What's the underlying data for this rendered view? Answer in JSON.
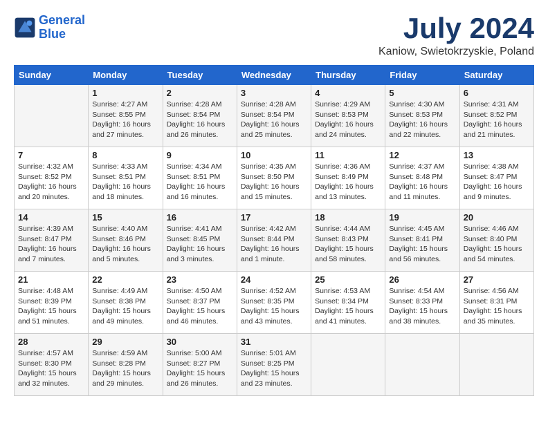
{
  "header": {
    "logo_line1": "General",
    "logo_line2": "Blue",
    "month_title": "July 2024",
    "location": "Kaniow, Swietokrzyskie, Poland"
  },
  "weekdays": [
    "Sunday",
    "Monday",
    "Tuesday",
    "Wednesday",
    "Thursday",
    "Friday",
    "Saturday"
  ],
  "weeks": [
    [
      {
        "day": "",
        "info": ""
      },
      {
        "day": "1",
        "info": "Sunrise: 4:27 AM\nSunset: 8:55 PM\nDaylight: 16 hours\nand 27 minutes."
      },
      {
        "day": "2",
        "info": "Sunrise: 4:28 AM\nSunset: 8:54 PM\nDaylight: 16 hours\nand 26 minutes."
      },
      {
        "day": "3",
        "info": "Sunrise: 4:28 AM\nSunset: 8:54 PM\nDaylight: 16 hours\nand 25 minutes."
      },
      {
        "day": "4",
        "info": "Sunrise: 4:29 AM\nSunset: 8:53 PM\nDaylight: 16 hours\nand 24 minutes."
      },
      {
        "day": "5",
        "info": "Sunrise: 4:30 AM\nSunset: 8:53 PM\nDaylight: 16 hours\nand 22 minutes."
      },
      {
        "day": "6",
        "info": "Sunrise: 4:31 AM\nSunset: 8:52 PM\nDaylight: 16 hours\nand 21 minutes."
      }
    ],
    [
      {
        "day": "7",
        "info": "Sunrise: 4:32 AM\nSunset: 8:52 PM\nDaylight: 16 hours\nand 20 minutes."
      },
      {
        "day": "8",
        "info": "Sunrise: 4:33 AM\nSunset: 8:51 PM\nDaylight: 16 hours\nand 18 minutes."
      },
      {
        "day": "9",
        "info": "Sunrise: 4:34 AM\nSunset: 8:51 PM\nDaylight: 16 hours\nand 16 minutes."
      },
      {
        "day": "10",
        "info": "Sunrise: 4:35 AM\nSunset: 8:50 PM\nDaylight: 16 hours\nand 15 minutes."
      },
      {
        "day": "11",
        "info": "Sunrise: 4:36 AM\nSunset: 8:49 PM\nDaylight: 16 hours\nand 13 minutes."
      },
      {
        "day": "12",
        "info": "Sunrise: 4:37 AM\nSunset: 8:48 PM\nDaylight: 16 hours\nand 11 minutes."
      },
      {
        "day": "13",
        "info": "Sunrise: 4:38 AM\nSunset: 8:47 PM\nDaylight: 16 hours\nand 9 minutes."
      }
    ],
    [
      {
        "day": "14",
        "info": "Sunrise: 4:39 AM\nSunset: 8:47 PM\nDaylight: 16 hours\nand 7 minutes."
      },
      {
        "day": "15",
        "info": "Sunrise: 4:40 AM\nSunset: 8:46 PM\nDaylight: 16 hours\nand 5 minutes."
      },
      {
        "day": "16",
        "info": "Sunrise: 4:41 AM\nSunset: 8:45 PM\nDaylight: 16 hours\nand 3 minutes."
      },
      {
        "day": "17",
        "info": "Sunrise: 4:42 AM\nSunset: 8:44 PM\nDaylight: 16 hours\nand 1 minute."
      },
      {
        "day": "18",
        "info": "Sunrise: 4:44 AM\nSunset: 8:43 PM\nDaylight: 15 hours\nand 58 minutes."
      },
      {
        "day": "19",
        "info": "Sunrise: 4:45 AM\nSunset: 8:41 PM\nDaylight: 15 hours\nand 56 minutes."
      },
      {
        "day": "20",
        "info": "Sunrise: 4:46 AM\nSunset: 8:40 PM\nDaylight: 15 hours\nand 54 minutes."
      }
    ],
    [
      {
        "day": "21",
        "info": "Sunrise: 4:48 AM\nSunset: 8:39 PM\nDaylight: 15 hours\nand 51 minutes."
      },
      {
        "day": "22",
        "info": "Sunrise: 4:49 AM\nSunset: 8:38 PM\nDaylight: 15 hours\nand 49 minutes."
      },
      {
        "day": "23",
        "info": "Sunrise: 4:50 AM\nSunset: 8:37 PM\nDaylight: 15 hours\nand 46 minutes."
      },
      {
        "day": "24",
        "info": "Sunrise: 4:52 AM\nSunset: 8:35 PM\nDaylight: 15 hours\nand 43 minutes."
      },
      {
        "day": "25",
        "info": "Sunrise: 4:53 AM\nSunset: 8:34 PM\nDaylight: 15 hours\nand 41 minutes."
      },
      {
        "day": "26",
        "info": "Sunrise: 4:54 AM\nSunset: 8:33 PM\nDaylight: 15 hours\nand 38 minutes."
      },
      {
        "day": "27",
        "info": "Sunrise: 4:56 AM\nSunset: 8:31 PM\nDaylight: 15 hours\nand 35 minutes."
      }
    ],
    [
      {
        "day": "28",
        "info": "Sunrise: 4:57 AM\nSunset: 8:30 PM\nDaylight: 15 hours\nand 32 minutes."
      },
      {
        "day": "29",
        "info": "Sunrise: 4:59 AM\nSunset: 8:28 PM\nDaylight: 15 hours\nand 29 minutes."
      },
      {
        "day": "30",
        "info": "Sunrise: 5:00 AM\nSunset: 8:27 PM\nDaylight: 15 hours\nand 26 minutes."
      },
      {
        "day": "31",
        "info": "Sunrise: 5:01 AM\nSunset: 8:25 PM\nDaylight: 15 hours\nand 23 minutes."
      },
      {
        "day": "",
        "info": ""
      },
      {
        "day": "",
        "info": ""
      },
      {
        "day": "",
        "info": ""
      }
    ]
  ]
}
